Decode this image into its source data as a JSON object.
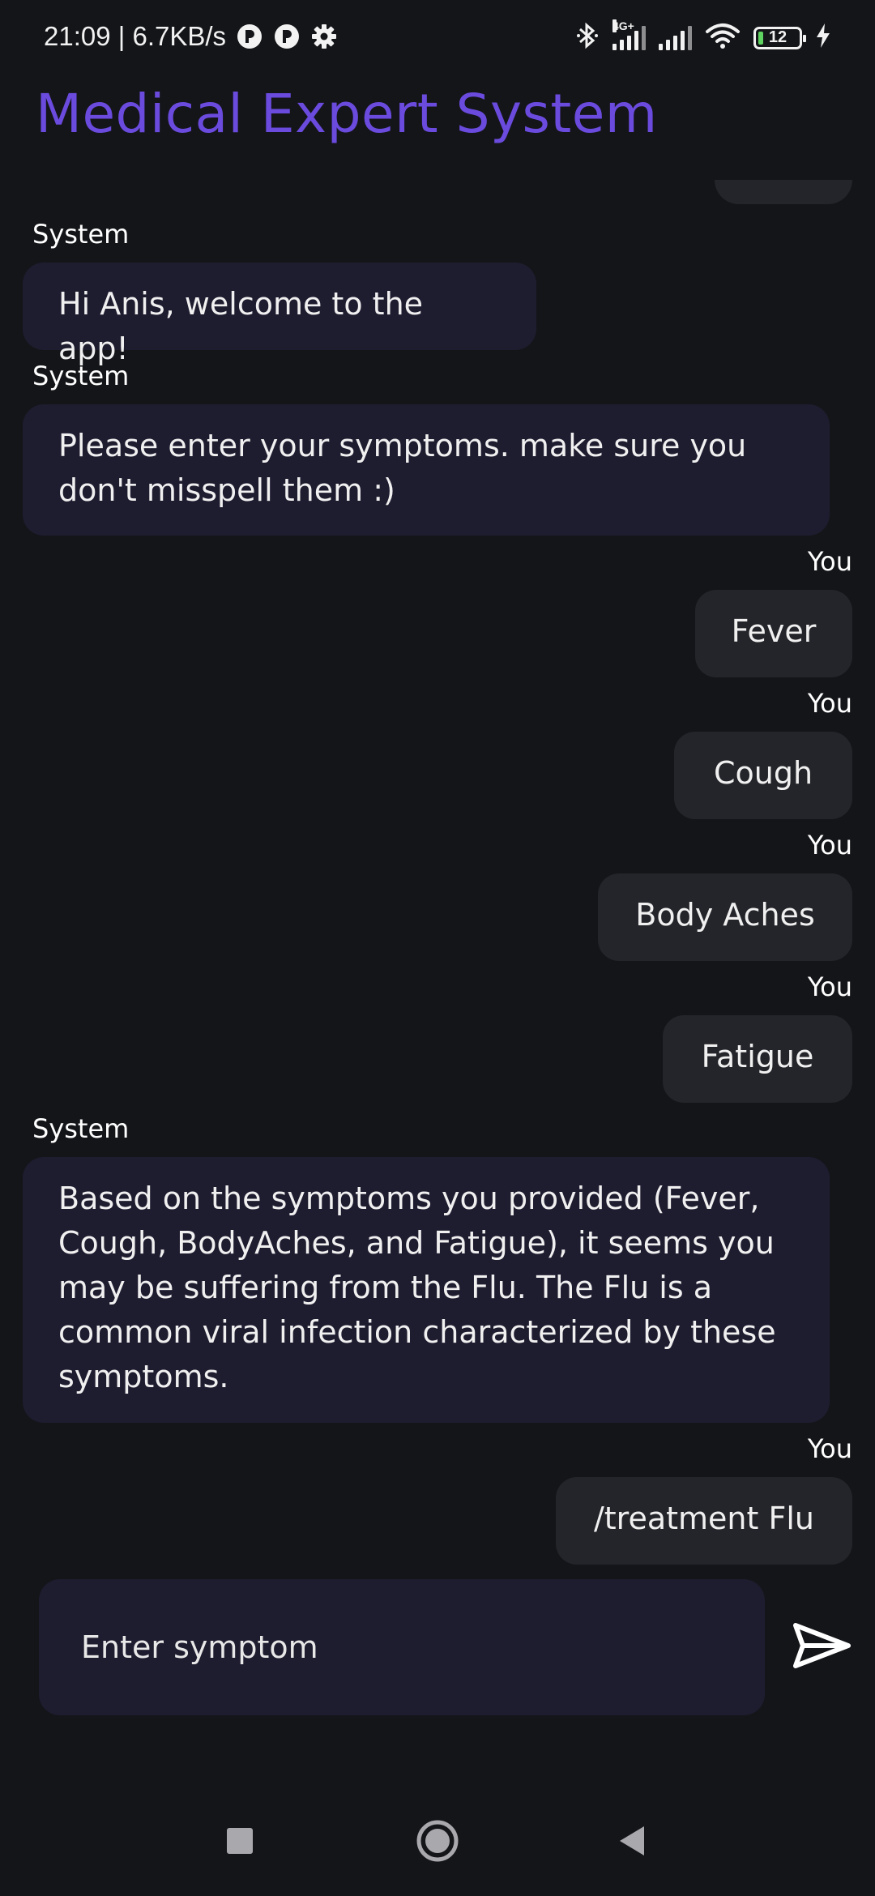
{
  "status_bar": {
    "time_speed": "21:09 | 6.7KB/s",
    "network_type": "4G+",
    "battery_level": "12",
    "battery_fraction": 0.12,
    "icons": [
      "p-app-icon",
      "p-app-icon",
      "gear-icon",
      "bluetooth-icon",
      "signal-icon",
      "signal-icon",
      "wifi-icon",
      "battery-icon",
      "charging-icon"
    ]
  },
  "app": {
    "title": "Medical Expert System",
    "title_color": "#6a4bde"
  },
  "chat": {
    "messages": [
      {
        "sender": "System",
        "text": "Hi Anis, welcome to the app!"
      },
      {
        "sender": "System",
        "text": "Please enter your symptoms. make sure you don't misspell them :)"
      },
      {
        "sender": "You",
        "text": "Fever"
      },
      {
        "sender": "You",
        "text": "Cough"
      },
      {
        "sender": "You",
        "text": "Body Aches"
      },
      {
        "sender": "You",
        "text": "Fatigue"
      },
      {
        "sender": "System",
        "text": "Based on the symptoms you provided (Fever, Cough, BodyAches, and Fatigue), it seems you may be suffering from the Flu. The Flu is a common viral infection characterized by these symptoms."
      },
      {
        "sender": "You",
        "text": "/treatment Flu"
      }
    ]
  },
  "composer": {
    "placeholder": "Enter symptom",
    "send_icon": "send-icon"
  },
  "navigation": {
    "buttons": [
      "recents-square-icon",
      "home-circle-icon",
      "back-triangle-icon"
    ]
  },
  "colors": {
    "background": "#141519",
    "system_bubble": "#1e1c2f",
    "user_bubble": "#24252a"
  }
}
